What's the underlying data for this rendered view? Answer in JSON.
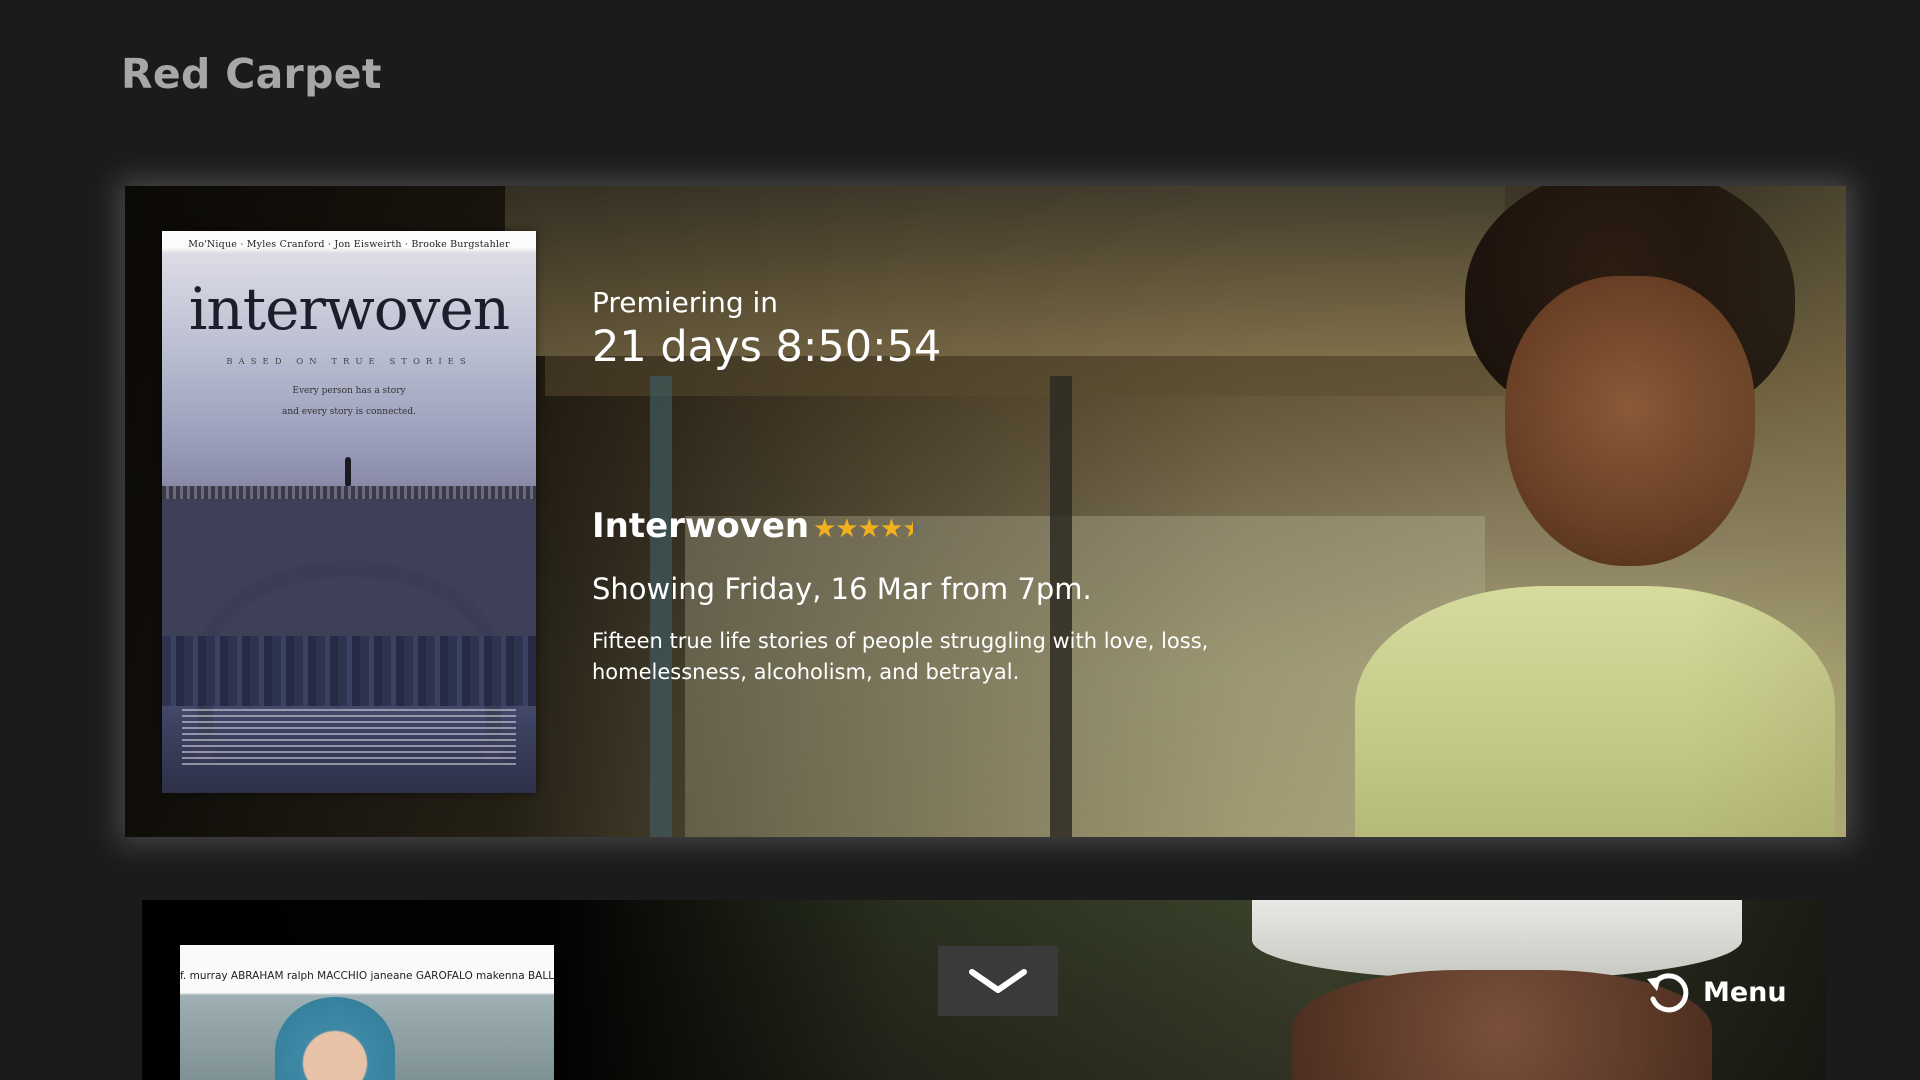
{
  "app": {
    "title": "Red Carpet"
  },
  "featured": {
    "premiere_label": "Premiering in",
    "countdown": "21 days 8:50:54",
    "title": "Interwoven",
    "rating": 4.5,
    "rating_max": 5,
    "rating_color": "#f2b01e",
    "showing": "Showing Friday, 16 Mar from 7pm.",
    "synopsis": "Fifteen true life stories of people struggling with love, loss, homelessness, alcoholism, and betrayal.",
    "poster": {
      "cast": "Mo'Nique  ·  Myles Cranford  ·  Jon Eisweirth  ·  Brooke Burgstahler",
      "title": "interwoven",
      "subtitle": "BASED ON TRUE STORIES",
      "tagline_1": "Every person has a story",
      "tagline_2": "and every story is connected."
    }
  },
  "next": {
    "poster_cast": "f. murray ABRAHAM  ralph MACCHIO  janeane GAROFALO  makenna BALLARD  olympia DUKAKIS"
  },
  "controls": {
    "scroll_icon": "chevron-down-icon",
    "menu_icon": "refresh-icon",
    "menu_label": "Menu"
  }
}
